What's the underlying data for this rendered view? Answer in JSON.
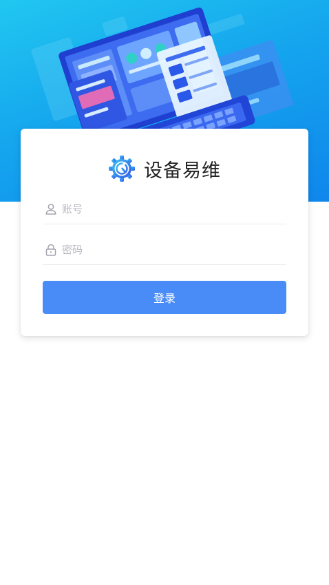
{
  "app": {
    "title": "设备易维"
  },
  "login": {
    "account_placeholder": "账号",
    "password_placeholder": "密码",
    "submit_label": "登录"
  },
  "icons": {
    "header_illustration": "laptop-dashboard-illustration",
    "logo": "gear-wrench-icon",
    "account": "user-icon",
    "password": "lock-icon"
  },
  "colors": {
    "hero_top": "#21c7f0",
    "hero_bottom": "#0f86ec",
    "button": "#4a8cf7",
    "title": "#222222",
    "placeholder": "#b7b7c2"
  }
}
